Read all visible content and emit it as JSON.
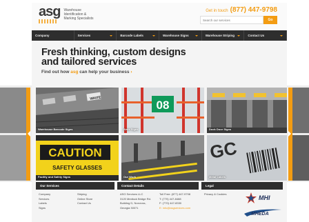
{
  "header": {
    "logo": "asg",
    "tagline": [
      "Warehouse",
      "Identification &",
      "Marking Specialists"
    ],
    "contact_prefix": "Get in touch",
    "phone": "(877) 447-9798",
    "search_placeholder": "Search our services",
    "search_button": "Go"
  },
  "nav": [
    {
      "label": "Company"
    },
    {
      "label": "Services"
    },
    {
      "label": "Barcode Labels"
    },
    {
      "label": "Warehouse Signs"
    },
    {
      "label": "Warehouse Striping"
    },
    {
      "label": "Contact Us"
    }
  ],
  "hero": {
    "title_line1": "Fresh thinking, custom designs",
    "title_line2": "and tailored services",
    "sub_prefix": "Find out how ",
    "sub_brand": "asg",
    "sub_suffix": " can help your business",
    "sub_arrow": "›"
  },
  "tiles": [
    {
      "label": "Warehouse Barcode Signs",
      "sign_text": "WHITE"
    },
    {
      "label": "Aisle Signs",
      "sign_text": "08"
    },
    {
      "label": "Dock Door Signs"
    },
    {
      "label": "Facility and Safety Signs",
      "sign_text": "CAUTION",
      "sign_sub": "SAFETY GLASSES"
    },
    {
      "label": "Our Work"
    },
    {
      "label": "Metal Labels",
      "sign_text": "GC"
    }
  ],
  "footer": {
    "services_heading": "Our Services",
    "services_col1": [
      "Company",
      "Services",
      "Labels",
      "Signs"
    ],
    "services_col2": [
      "Striping",
      "Online Store",
      "Contact Us"
    ],
    "details_heading": "Contact Details",
    "address": [
      "ASG Services LLC",
      "3120 Medlock Bridge Rd.",
      "Building D, Norcross,",
      "Georgia 30071"
    ],
    "phones": [
      "Toll Free: (877) 447-9798",
      "T: (770) 447-8488",
      "F: (770) 447-8330",
      "E: info@asgservices.com"
    ],
    "legal_heading": "Legal",
    "legal_link": "Privacy & Cookies",
    "badge1": "MHI",
    "badge2": "MHEDA"
  }
}
